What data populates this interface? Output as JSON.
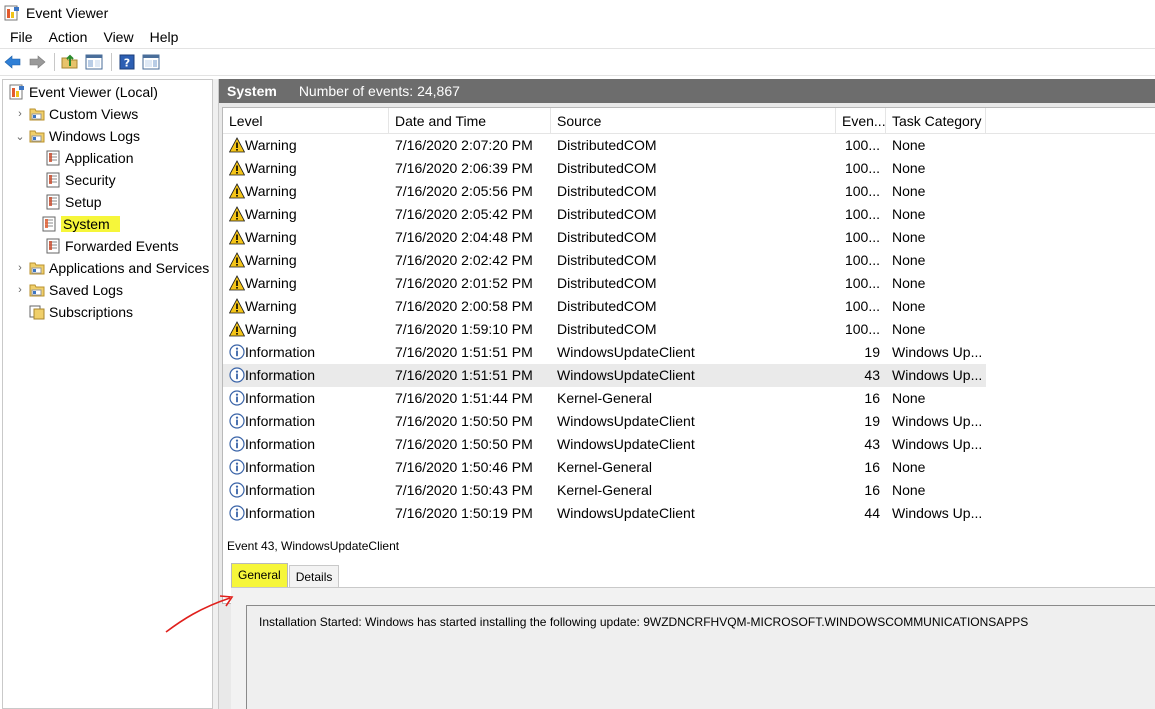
{
  "window": {
    "title": "Event Viewer"
  },
  "menu": [
    "File",
    "Action",
    "View",
    "Help"
  ],
  "tree": {
    "items": [
      {
        "label": "Event Viewer (Local)",
        "indent": 0,
        "chevron": "",
        "icon": "event-viewer-icon"
      },
      {
        "label": "Custom Views",
        "indent": 1,
        "chevron": "›",
        "icon": "folder-icon"
      },
      {
        "label": "Windows Logs",
        "indent": 1,
        "chevron": "⌄",
        "icon": "folder-icon"
      },
      {
        "label": "Application",
        "indent": 2,
        "chevron": "",
        "icon": "log-icon"
      },
      {
        "label": "Security",
        "indent": 2,
        "chevron": "",
        "icon": "log-icon"
      },
      {
        "label": "Setup",
        "indent": 2,
        "chevron": "",
        "icon": "log-icon"
      },
      {
        "label": "System",
        "indent": 2,
        "chevron": "",
        "icon": "log-icon",
        "highlighted": true
      },
      {
        "label": "Forwarded Events",
        "indent": 2,
        "chevron": "",
        "icon": "log-icon"
      },
      {
        "label": "Applications and Services Lo",
        "indent": 1,
        "chevron": "›",
        "icon": "folder-icon"
      },
      {
        "label": "Saved Logs",
        "indent": 1,
        "chevron": "›",
        "icon": "folder-icon"
      },
      {
        "label": "Subscriptions",
        "indent": 1,
        "chevron": "",
        "icon": "subscriptions-icon"
      }
    ]
  },
  "pane": {
    "log_name": "System",
    "count_label": "Number of events: 24,867"
  },
  "grid": {
    "columns": [
      "Level",
      "Date and Time",
      "Source",
      "Even...",
      "Task Category"
    ],
    "rows": [
      {
        "level": "Warning",
        "date": "7/16/2020 2:07:20 PM",
        "source": "DistributedCOM",
        "event": "100...",
        "task": "None"
      },
      {
        "level": "Warning",
        "date": "7/16/2020 2:06:39 PM",
        "source": "DistributedCOM",
        "event": "100...",
        "task": "None"
      },
      {
        "level": "Warning",
        "date": "7/16/2020 2:05:56 PM",
        "source": "DistributedCOM",
        "event": "100...",
        "task": "None"
      },
      {
        "level": "Warning",
        "date": "7/16/2020 2:05:42 PM",
        "source": "DistributedCOM",
        "event": "100...",
        "task": "None"
      },
      {
        "level": "Warning",
        "date": "7/16/2020 2:04:48 PM",
        "source": "DistributedCOM",
        "event": "100...",
        "task": "None"
      },
      {
        "level": "Warning",
        "date": "7/16/2020 2:02:42 PM",
        "source": "DistributedCOM",
        "event": "100...",
        "task": "None"
      },
      {
        "level": "Warning",
        "date": "7/16/2020 2:01:52 PM",
        "source": "DistributedCOM",
        "event": "100...",
        "task": "None"
      },
      {
        "level": "Warning",
        "date": "7/16/2020 2:00:58 PM",
        "source": "DistributedCOM",
        "event": "100...",
        "task": "None"
      },
      {
        "level": "Warning",
        "date": "7/16/2020 1:59:10 PM",
        "source": "DistributedCOM",
        "event": "100...",
        "task": "None"
      },
      {
        "level": "Information",
        "date": "7/16/2020 1:51:51 PM",
        "source": "WindowsUpdateClient",
        "event": "19",
        "task": "Windows Up..."
      },
      {
        "level": "Information",
        "date": "7/16/2020 1:51:51 PM",
        "source": "WindowsUpdateClient",
        "event": "43",
        "task": "Windows Up...",
        "selected": true
      },
      {
        "level": "Information",
        "date": "7/16/2020 1:51:44 PM",
        "source": "Kernel-General",
        "event": "16",
        "task": "None"
      },
      {
        "level": "Information",
        "date": "7/16/2020 1:50:50 PM",
        "source": "WindowsUpdateClient",
        "event": "19",
        "task": "Windows Up..."
      },
      {
        "level": "Information",
        "date": "7/16/2020 1:50:50 PM",
        "source": "WindowsUpdateClient",
        "event": "43",
        "task": "Windows Up..."
      },
      {
        "level": "Information",
        "date": "7/16/2020 1:50:46 PM",
        "source": "Kernel-General",
        "event": "16",
        "task": "None"
      },
      {
        "level": "Information",
        "date": "7/16/2020 1:50:43 PM",
        "source": "Kernel-General",
        "event": "16",
        "task": "None"
      },
      {
        "level": "Information",
        "date": "7/16/2020 1:50:19 PM",
        "source": "WindowsUpdateClient",
        "event": "44",
        "task": "Windows Up..."
      }
    ]
  },
  "detail": {
    "title": "Event 43, WindowsUpdateClient",
    "tabs": [
      "General",
      "Details"
    ],
    "active_tab": "General",
    "message": "Installation Started: Windows has started installing the following update: 9WZDNCRFHVQM-MICROSOFT.WINDOWSCOMMUNICATIONSAPPS"
  },
  "colors": {
    "highlight": "#f6f63a",
    "header_bg": "#6d6d6d",
    "annotation": "#e0201c",
    "warning": "#f5c518",
    "info": "#3a64a8"
  }
}
